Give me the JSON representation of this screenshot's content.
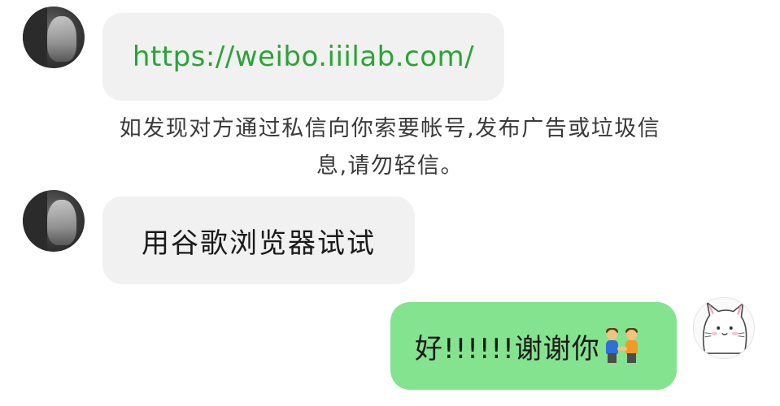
{
  "messages": [
    {
      "sender": "other",
      "type": "link",
      "text": "https://weibo.iiilab.com/",
      "color": "#2ba336"
    },
    {
      "sender": "other",
      "type": "text",
      "text": "用谷歌浏览器试试"
    },
    {
      "sender": "self",
      "type": "text",
      "text": "好!!!!!!谢谢你",
      "emoji": "two-men-holding-hands-emoji"
    }
  ],
  "notice": {
    "line1": "如发现对方通过私信向你索要帐号,发布广告或垃圾信",
    "line2": "息,请勿轻信。"
  },
  "avatars": {
    "other": "photo-avatar",
    "self": "cat-avatar"
  },
  "colors": {
    "incoming_bubble": "#f1f1f1",
    "outgoing_bubble": "#84e38e",
    "link": "#2ba336",
    "notice_text": "#3a3a3a"
  }
}
